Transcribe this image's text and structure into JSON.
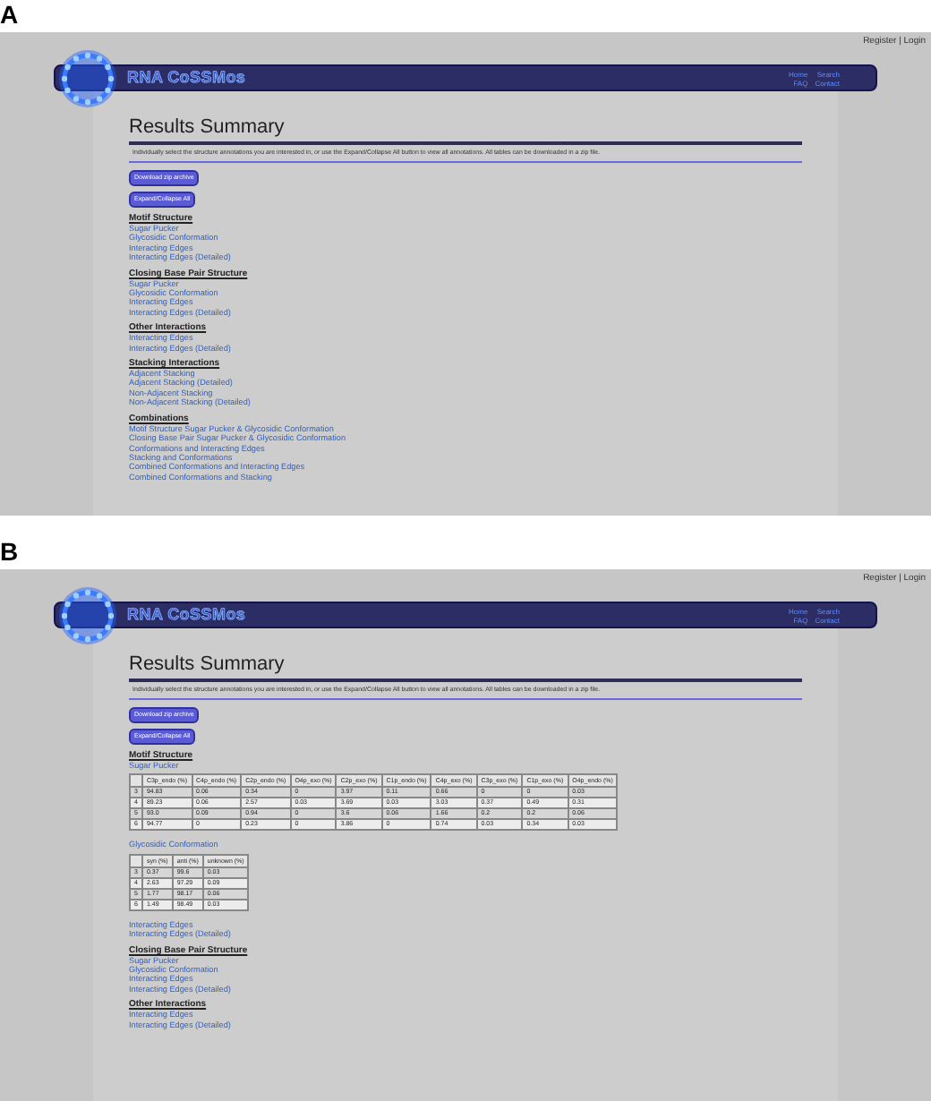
{
  "panels": [
    {
      "label": "A",
      "account_links": "Register | Login",
      "site_name": "RNA CoSSMos",
      "nav": [
        "Home",
        "Search",
        "FAQ",
        "Contact"
      ],
      "title": "Results Summary",
      "description": "Individually select the structure annotations you are interested in, or use the Expand/Collapse All button to view all annotations. All tables can be downloaded in a zip file.",
      "buttons": [
        "Download zip archive",
        "Expand/Collapse All"
      ],
      "sections": [
        {
          "heading": "Motif Structure",
          "items": [
            {
              "label": "Sugar Pucker"
            },
            {
              "label": "Glycosidic Conformation"
            },
            {
              "label": "Interacting Edges"
            },
            {
              "label": "Interacting Edges (Detailed)"
            }
          ]
        },
        {
          "heading": "Closing Base Pair Structure",
          "items": [
            {
              "label": "Sugar Pucker"
            },
            {
              "label": "Glycosidic Conformation"
            },
            {
              "label": "Interacting Edges"
            },
            {
              "label": "Interacting Edges (Detailed)"
            }
          ]
        },
        {
          "heading": "Other Interactions",
          "items": [
            {
              "label": "Interacting Edges"
            },
            {
              "label": "Interacting Edges (Detailed)"
            }
          ]
        },
        {
          "heading": "Stacking Interactions",
          "items": [
            {
              "label": "Adjacent Stacking"
            },
            {
              "label": "Adjacent Stacking (Detailed)"
            },
            {
              "label": "Non-Adjacent Stacking"
            },
            {
              "label": "Non-Adjacent Stacking (Detailed)"
            }
          ]
        },
        {
          "heading": "Combinations",
          "items": [
            {
              "label": "Motif Structure Sugar Pucker & Glycosidic Conformation"
            },
            {
              "label": "Closing Base Pair Sugar Pucker & Glycosidic Conformation"
            },
            {
              "label": "Conformations and Interacting Edges"
            },
            {
              "label": "Stacking and Conformations"
            },
            {
              "label": "Combined Conformations and Interacting Edges"
            },
            {
              "label": "Combined Conformations and Stacking"
            }
          ]
        }
      ]
    },
    {
      "label": "B",
      "account_links": "Register | Login",
      "site_name": "RNA CoSSMos",
      "nav": [
        "Home",
        "Search",
        "FAQ",
        "Contact"
      ],
      "title": "Results Summary",
      "description": "Individually select the structure annotations you are interested in, or use the Expand/Collapse All button to view all annotations. All tables can be downloaded in a zip file.",
      "buttons": [
        "Download zip archive",
        "Expand/Collapse All"
      ],
      "sections": [
        {
          "heading": "Motif Structure",
          "items": [
            {
              "label": "Sugar Pucker",
              "table": {
                "columns": [
                  "",
                  "C3p_endo (%)",
                  "C4p_endo (%)",
                  "C2p_endo (%)",
                  "O4p_exo (%)",
                  "C2p_exo (%)",
                  "C1p_endo (%)",
                  "C4p_exo (%)",
                  "C3p_exo (%)",
                  "C1p_exo (%)",
                  "O4p_endo (%)"
                ],
                "rows": [
                  [
                    "3",
                    "94.83",
                    "0.06",
                    "0.34",
                    "0",
                    "3.97",
                    "0.11",
                    "0.66",
                    "0",
                    "0",
                    "0.03"
                  ],
                  [
                    "4",
                    "89.23",
                    "0.06",
                    "2.57",
                    "0.03",
                    "3.69",
                    "0.03",
                    "3.03",
                    "0.37",
                    "0.49",
                    "0.31"
                  ],
                  [
                    "5",
                    "93.0",
                    "0.09",
                    "0.94",
                    "0",
                    "3.6",
                    "0.06",
                    "1.66",
                    "0.2",
                    "0.2",
                    "0.06"
                  ],
                  [
                    "6",
                    "94.77",
                    "0",
                    "0.23",
                    "0",
                    "3.86",
                    "0",
                    "0.74",
                    "0.03",
                    "0.34",
                    "0.03"
                  ]
                ]
              }
            },
            {
              "label": "Glycosidic Conformation",
              "table": {
                "columns": [
                  "",
                  "syn (%)",
                  "anti (%)",
                  "unknown (%)"
                ],
                "rows": [
                  [
                    "3",
                    "0.37",
                    "99.6",
                    "0.03"
                  ],
                  [
                    "4",
                    "2.63",
                    "97.29",
                    "0.09"
                  ],
                  [
                    "5",
                    "1.77",
                    "98.17",
                    "0.06"
                  ],
                  [
                    "6",
                    "1.49",
                    "98.49",
                    "0.03"
                  ]
                ]
              }
            },
            {
              "label": "Interacting Edges"
            },
            {
              "label": "Interacting Edges (Detailed)"
            }
          ]
        },
        {
          "heading": "Closing Base Pair Structure",
          "items": [
            {
              "label": "Sugar Pucker"
            },
            {
              "label": "Glycosidic Conformation"
            },
            {
              "label": "Interacting Edges"
            },
            {
              "label": "Interacting Edges (Detailed)"
            }
          ]
        },
        {
          "heading": "Other Interactions",
          "items": [
            {
              "label": "Interacting Edges"
            },
            {
              "label": "Interacting Edges (Detailed)"
            }
          ]
        }
      ]
    }
  ]
}
